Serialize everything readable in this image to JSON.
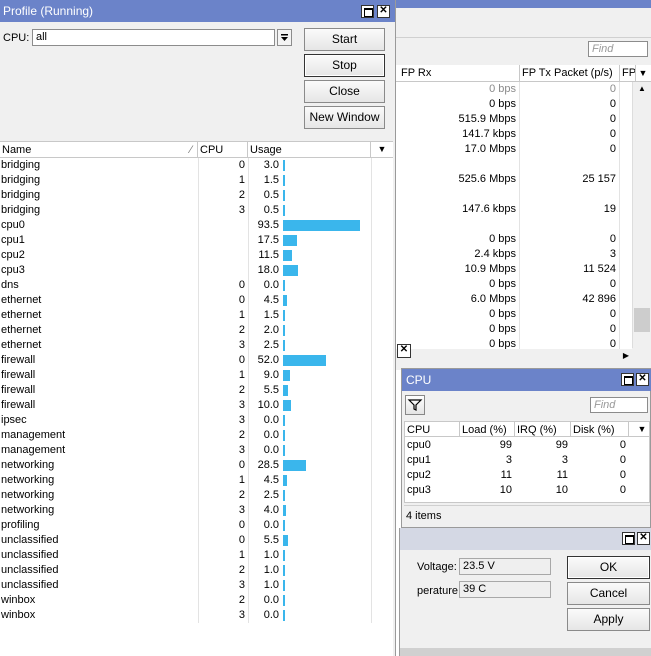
{
  "profile": {
    "title": "Profile (Running)",
    "cpu_label": "CPU:",
    "cpu_value": "all",
    "buttons": {
      "start": "Start",
      "stop": "Stop",
      "close": "Close",
      "new_window": "New Window"
    },
    "columns": {
      "name": "Name",
      "cpu": "CPU",
      "usage": "Usage"
    },
    "rows": [
      {
        "name": "bridging",
        "cpu": "0",
        "usage": "3.0",
        "pct": 3.0
      },
      {
        "name": "bridging",
        "cpu": "1",
        "usage": "1.5",
        "pct": 1.5
      },
      {
        "name": "bridging",
        "cpu": "2",
        "usage": "0.5",
        "pct": 0.5
      },
      {
        "name": "bridging",
        "cpu": "3",
        "usage": "0.5",
        "pct": 0.5
      },
      {
        "name": "cpu0",
        "cpu": "",
        "usage": "93.5",
        "pct": 93.5
      },
      {
        "name": "cpu1",
        "cpu": "",
        "usage": "17.5",
        "pct": 17.5
      },
      {
        "name": "cpu2",
        "cpu": "",
        "usage": "11.5",
        "pct": 11.5
      },
      {
        "name": "cpu3",
        "cpu": "",
        "usage": "18.0",
        "pct": 18.0
      },
      {
        "name": "dns",
        "cpu": "0",
        "usage": "0.0",
        "pct": 0
      },
      {
        "name": "ethernet",
        "cpu": "0",
        "usage": "4.5",
        "pct": 4.5
      },
      {
        "name": "ethernet",
        "cpu": "1",
        "usage": "1.5",
        "pct": 1.5
      },
      {
        "name": "ethernet",
        "cpu": "2",
        "usage": "2.0",
        "pct": 2.0
      },
      {
        "name": "ethernet",
        "cpu": "3",
        "usage": "2.5",
        "pct": 2.5
      },
      {
        "name": "firewall",
        "cpu": "0",
        "usage": "52.0",
        "pct": 52.0
      },
      {
        "name": "firewall",
        "cpu": "1",
        "usage": "9.0",
        "pct": 9.0
      },
      {
        "name": "firewall",
        "cpu": "2",
        "usage": "5.5",
        "pct": 5.5
      },
      {
        "name": "firewall",
        "cpu": "3",
        "usage": "10.0",
        "pct": 10.0
      },
      {
        "name": "ipsec",
        "cpu": "3",
        "usage": "0.0",
        "pct": 0
      },
      {
        "name": "management",
        "cpu": "2",
        "usage": "0.0",
        "pct": 0
      },
      {
        "name": "management",
        "cpu": "3",
        "usage": "0.0",
        "pct": 0
      },
      {
        "name": "networking",
        "cpu": "0",
        "usage": "28.5",
        "pct": 28.5
      },
      {
        "name": "networking",
        "cpu": "1",
        "usage": "4.5",
        "pct": 4.5
      },
      {
        "name": "networking",
        "cpu": "2",
        "usage": "2.5",
        "pct": 2.5
      },
      {
        "name": "networking",
        "cpu": "3",
        "usage": "4.0",
        "pct": 4.0
      },
      {
        "name": "profiling",
        "cpu": "0",
        "usage": "0.0",
        "pct": 0
      },
      {
        "name": "unclassified",
        "cpu": "0",
        "usage": "5.5",
        "pct": 5.5
      },
      {
        "name": "unclassified",
        "cpu": "1",
        "usage": "1.0",
        "pct": 1.0
      },
      {
        "name": "unclassified",
        "cpu": "2",
        "usage": "1.0",
        "pct": 1.0
      },
      {
        "name": "unclassified",
        "cpu": "3",
        "usage": "1.0",
        "pct": 1.0
      },
      {
        "name": "winbox",
        "cpu": "2",
        "usage": "0.0",
        "pct": 0
      },
      {
        "name": "winbox",
        "cpu": "3",
        "usage": "0.0",
        "pct": 0
      }
    ]
  },
  "traffic": {
    "find_placeholder": "Find",
    "columns": {
      "fp_rx": "FP Rx",
      "fp_tx_packet": "FP Tx Packet (p/s)",
      "fp_more": "FP"
    },
    "rows": [
      {
        "rx": "0 bps",
        "tx": "0",
        "dim": true
      },
      {
        "rx": "0 bps",
        "tx": "0"
      },
      {
        "rx": "515.9 Mbps",
        "tx": "0"
      },
      {
        "rx": "141.7 kbps",
        "tx": "0"
      },
      {
        "rx": "17.0 Mbps",
        "tx": "0"
      },
      {
        "rx": "",
        "tx": ""
      },
      {
        "rx": "525.6 Mbps",
        "tx": "25 157"
      },
      {
        "rx": "",
        "tx": ""
      },
      {
        "rx": "147.6 kbps",
        "tx": "19"
      },
      {
        "rx": "",
        "tx": ""
      },
      {
        "rx": "0 bps",
        "tx": "0"
      },
      {
        "rx": "2.4 kbps",
        "tx": "3"
      },
      {
        "rx": "10.9 Mbps",
        "tx": "11 524"
      },
      {
        "rx": "0 bps",
        "tx": "0"
      },
      {
        "rx": "6.0 Mbps",
        "tx": "42 896"
      },
      {
        "rx": "0 bps",
        "tx": "0"
      },
      {
        "rx": "0 bps",
        "tx": "0"
      },
      {
        "rx": "0 bps",
        "tx": "0"
      }
    ]
  },
  "cpu_window": {
    "title": "CPU",
    "find_placeholder": "Find",
    "columns": {
      "cpu": "CPU",
      "load": "Load (%)",
      "irq": "IRQ (%)",
      "disk": "Disk (%)"
    },
    "rows": [
      {
        "cpu": "cpu0",
        "load": "99",
        "irq": "99",
        "disk": "0"
      },
      {
        "cpu": "cpu1",
        "load": "3",
        "irq": "3",
        "disk": "0"
      },
      {
        "cpu": "cpu2",
        "load": "11",
        "irq": "11",
        "disk": "0"
      },
      {
        "cpu": "cpu3",
        "load": "10",
        "irq": "10",
        "disk": "0"
      }
    ],
    "status": "4 items"
  },
  "health_window": {
    "voltage_label": "Voltage:",
    "voltage_value": "23.5 V",
    "temperature_label": "perature:",
    "temperature_value": "39 C",
    "buttons": {
      "ok": "OK",
      "cancel": "Cancel",
      "apply": "Apply"
    }
  },
  "colors": {
    "title_bar": "#6b83c9",
    "usage_bar": "#3ab6ec",
    "inactive_title": "#d4d8e4"
  }
}
